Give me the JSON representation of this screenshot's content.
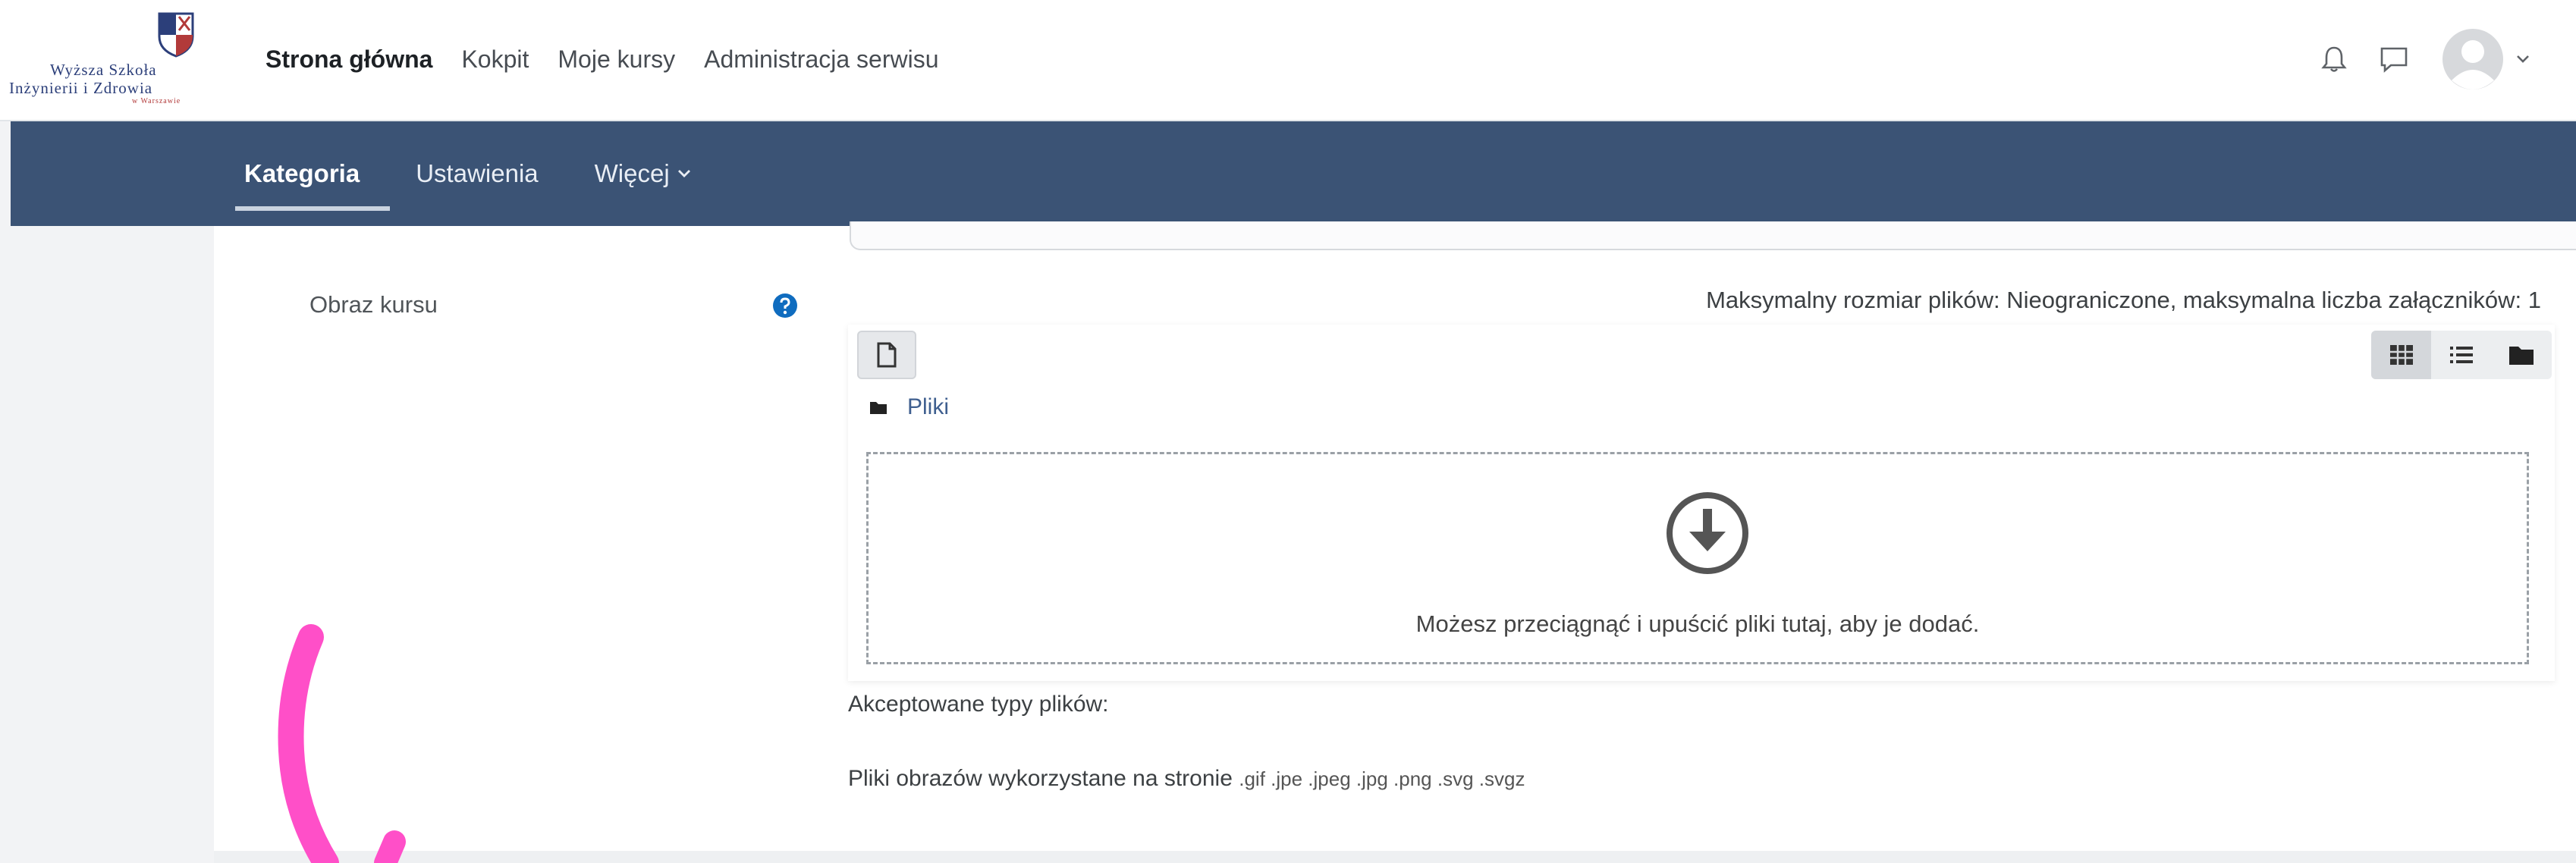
{
  "logo": {
    "line1": "Wyższa Szkoła",
    "line2": "Inżynierii i Zdrowia",
    "line3": "w Warszawie"
  },
  "topnav": {
    "items": [
      "Strona główna",
      "Kokpit",
      "Moje kursy",
      "Administracja serwisu"
    ],
    "active_index": 0
  },
  "top_icons": [
    "bell-icon",
    "chat-icon",
    "user-avatar",
    "chevron-down-icon"
  ],
  "subnav": {
    "tabs": [
      "Kategoria",
      "Ustawienia",
      "Więcej"
    ],
    "active_index": 0
  },
  "field": {
    "label": "Obraz kursu",
    "help_icon": "question-circle-icon",
    "max_size_text": "Maksymalny rozmiar plików: Nieograniczone, maksymalna liczba załączników: 1"
  },
  "filepicker": {
    "add_file_icon": "file-icon",
    "view_modes": [
      "grid-icon",
      "list-icon",
      "folder-icon"
    ],
    "active_view": 0,
    "breadcrumb": "Pliki",
    "dropzone_text": "Możesz przeciągnąć i upuścić pliki tutaj, aby je dodać."
  },
  "accepted": {
    "label": "Akceptowane typy plików:",
    "description": "Pliki obrazów wykorzystane na stronie",
    "extensions": ".gif .jpe .jpeg .jpg .png .svg .svgz"
  },
  "colors": {
    "subnav_bg": "#3b5375",
    "link": "#3f5f8f",
    "annotation": "#ff4fc8"
  }
}
